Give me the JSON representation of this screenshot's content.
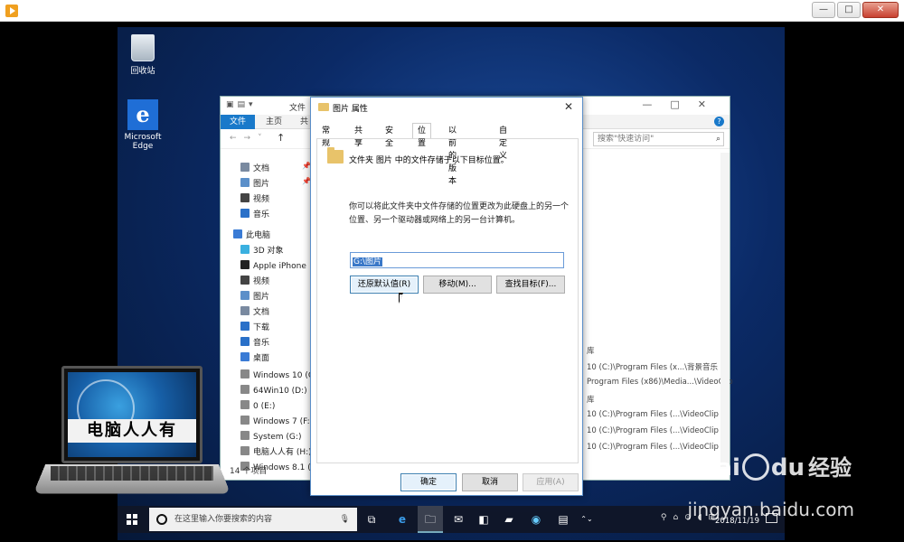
{
  "player": {
    "controls": [
      "—",
      "□",
      "✕"
    ]
  },
  "desktop": {
    "icons": [
      {
        "label": "回收站"
      },
      {
        "label": "Microsoft\nEdge",
        "line1": "Microsoft",
        "line2": "Edge"
      }
    ]
  },
  "explorer": {
    "ribbon": {
      "file": "文件",
      "home": "主页",
      "share": "共"
    },
    "title_fragment": "文件",
    "search_placeholder": "搜索\"快速访问\"",
    "nav_items": [
      {
        "label": "文档",
        "color": "#7a8aa0"
      },
      {
        "label": "图片",
        "color": "#5b8fc9"
      },
      {
        "label": "视频",
        "color": "#444"
      },
      {
        "label": "音乐",
        "color": "#2a70c8"
      },
      {
        "label": "此电脑",
        "color": "#3a7bd5"
      },
      {
        "label": "3D 对象",
        "color": "#3ab0e0"
      },
      {
        "label": "Apple iPhone",
        "color": "#222"
      },
      {
        "label": "视频",
        "color": "#444"
      },
      {
        "label": "图片",
        "color": "#5b8fc9"
      },
      {
        "label": "文档",
        "color": "#7a8aa0"
      },
      {
        "label": "下载",
        "color": "#2a70c8"
      },
      {
        "label": "音乐",
        "color": "#2a70c8"
      },
      {
        "label": "桌面",
        "color": "#3a7bd5"
      },
      {
        "label": "Windows 10 (C",
        "color": "#888"
      },
      {
        "label": "64Win10 (D:)",
        "color": "#888"
      },
      {
        "label": "0 (E:)",
        "color": "#888"
      },
      {
        "label": "Windows 7 (F:",
        "color": "#888"
      },
      {
        "label": "System (G:)",
        "color": "#888"
      },
      {
        "label": "电脑人人有 (H:)",
        "color": "#888"
      },
      {
        "label": "Windows 8.1 (",
        "color": "#888"
      }
    ],
    "right_items": [
      "库",
      "10 (C:)\\Program Files (x...\\背景音乐",
      "Program Files (x86)\\Media...\\VideoClip",
      "库",
      "10 (C:)\\Program Files (...\\VideoClip",
      "10 (C:)\\Program Files (...\\VideoClip",
      "10 (C:)\\Program Files (...\\VideoClip"
    ],
    "status": "14 个项目"
  },
  "dialog": {
    "title": "图片 属性",
    "tabs": [
      "常规",
      "共享",
      "安全",
      "位置",
      "以前的版本",
      "自定义"
    ],
    "active_tab": "位置",
    "location_line": "文件夹 图片 中的文件存储于以下目标位置。",
    "description_line1": "你可以将此文件夹中文件存储的位置更改为此硬盘上的另一个",
    "description_line2": "位置、另一个驱动器或网络上的另一台计算机。",
    "path_value": "G:\\图片",
    "buttons": {
      "restore": "还原默认值(R)",
      "move": "移动(M)...",
      "find": "查找目标(F)...",
      "ok": "确定",
      "cancel": "取消",
      "apply": "应用(A)"
    }
  },
  "taskbar": {
    "search_placeholder": "在这里输入你要搜索的内容",
    "clock_date": "2018/11/19"
  },
  "overlay": {
    "logo_text": "电脑人人有",
    "watermark_brand": "Bai",
    "watermark_brand2": "du",
    "watermark_cn": "经验",
    "watermark_url": "jingyan.baidu.com"
  }
}
